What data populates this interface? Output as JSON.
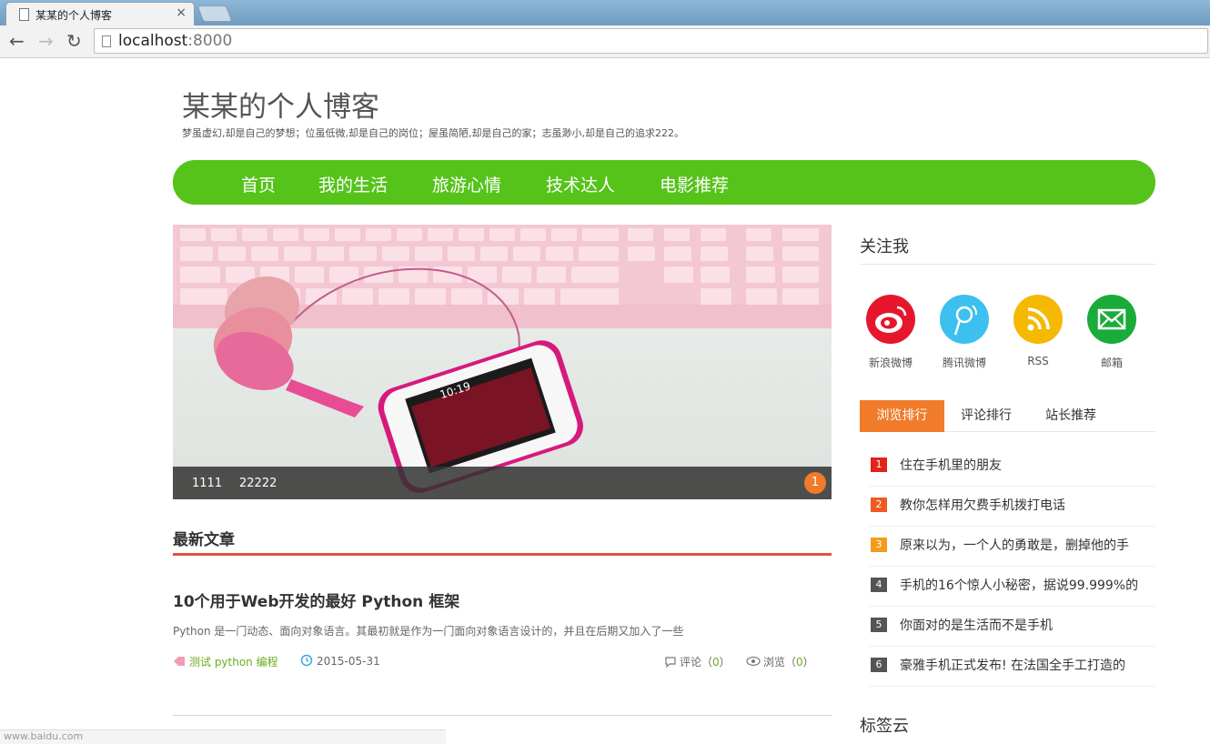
{
  "browser": {
    "tab_title": "某某的个人博客",
    "close_glyph": "×",
    "url_host": "localhost",
    "url_port": ":8000",
    "back_glyph": "←",
    "forward_glyph": "→",
    "reload_glyph": "↻"
  },
  "site": {
    "title": "某某的个人博客",
    "subtitle": "梦虽虚幻,却是自己的梦想；位虽低微,却是自己的岗位；屋虽简陋,却是自己的家；志虽渺小,却是自己的追求222。"
  },
  "nav": {
    "items": [
      "首页",
      "我的生活",
      "旅游心情",
      "技术达人",
      "电影推荐"
    ],
    "color": "#56c31b"
  },
  "banner": {
    "captions": [
      "1111",
      "22222"
    ],
    "page_indicator": "1"
  },
  "latest": {
    "section_title": "最新文章",
    "article": {
      "title": "10个用于Web开发的最好 Python 框架",
      "summary": "Python 是一门动态、面向对象语言。其最初就是作为一门面向对象语言设计的，并且在后期又加入了一些",
      "tags": "测试 python 编程",
      "date": "2015-05-31",
      "comment_label": "评论（",
      "comment_count": "0",
      "comment_close": "）",
      "view_label": "浏览（",
      "view_count": "0",
      "view_close": "）"
    }
  },
  "sidebar": {
    "follow_title": "关注我",
    "social": [
      {
        "label": "新浪微博",
        "icon": "weibo-icon",
        "color": "#e6162d"
      },
      {
        "label": "腾讯微博",
        "icon": "tencent-weibo-icon",
        "color": "#3cc0ef"
      },
      {
        "label": "RSS",
        "icon": "rss-icon",
        "color": "#f4b900"
      },
      {
        "label": "邮箱",
        "icon": "mail-icon",
        "color": "#1aab3a"
      }
    ],
    "rank_tabs": [
      "浏览排行",
      "评论排行",
      "站长推荐"
    ],
    "rank_items": [
      {
        "num": "1",
        "text": "住在手机里的朋友",
        "color": "#e2231a"
      },
      {
        "num": "2",
        "text": "教你怎样用欠费手机拨打电话",
        "color": "#f05a22"
      },
      {
        "num": "3",
        "text": "原来以为，一个人的勇敢是，删掉他的手",
        "color": "#f59b1b"
      },
      {
        "num": "4",
        "text": "手机的16个惊人小秘密，据说99.999%的",
        "color": "#555555"
      },
      {
        "num": "5",
        "text": "你面对的是生活而不是手机",
        "color": "#555555"
      },
      {
        "num": "6",
        "text": "豪雅手机正式发布! 在法国全手工打造的",
        "color": "#555555"
      }
    ],
    "tag_cloud_title": "标签云"
  },
  "status_bar": "www.baidu.com"
}
